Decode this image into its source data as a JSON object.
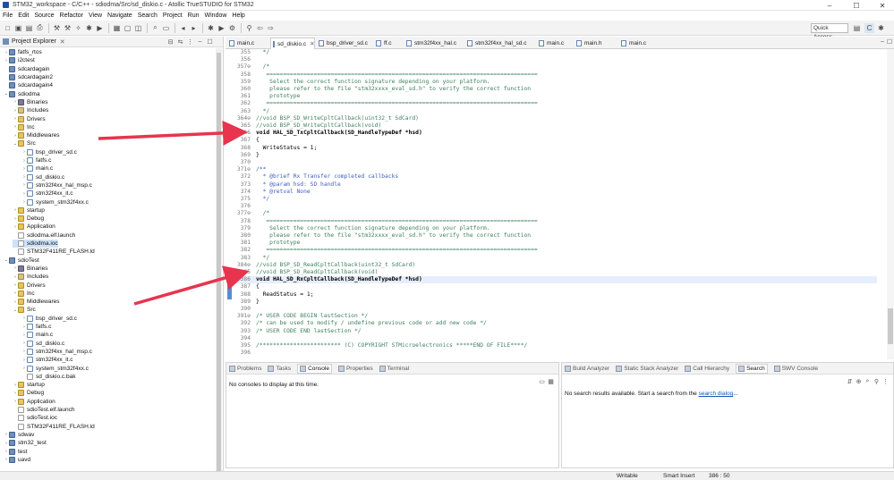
{
  "window": {
    "title": "STM32_workspace - C/C++ - sdiodma/Src/sd_diskio.c - Atollic TrueSTUDIO for STM32"
  },
  "menu": [
    "File",
    "Edit",
    "Source",
    "Refactor",
    "View",
    "Navigate",
    "Search",
    "Project",
    "Run",
    "Window",
    "Help"
  ],
  "quick_access": "Quick Access",
  "explorer": {
    "title": "Project Explorer",
    "items": [
      {
        "label": "fatfs_rtos",
        "depth": 0,
        "kind": "proj",
        "arrow": "›"
      },
      {
        "label": "i2ctest",
        "depth": 0,
        "kind": "proj",
        "arrow": "›"
      },
      {
        "label": "sdcardagain",
        "depth": 0,
        "kind": "proj",
        "arrow": ""
      },
      {
        "label": "sdcardagain2",
        "depth": 0,
        "kind": "proj",
        "arrow": ""
      },
      {
        "label": "sdcardagain4",
        "depth": 0,
        "kind": "proj",
        "arrow": ""
      },
      {
        "label": "sdiodma",
        "depth": 0,
        "kind": "proj",
        "arrow": "⌄"
      },
      {
        "label": "Binaries",
        "depth": 1,
        "kind": "bin",
        "arrow": "›"
      },
      {
        "label": "Includes",
        "depth": 1,
        "kind": "inc",
        "arrow": "›"
      },
      {
        "label": "Drivers",
        "depth": 1,
        "kind": "fold",
        "arrow": "›"
      },
      {
        "label": "Inc",
        "depth": 1,
        "kind": "fold",
        "arrow": "›"
      },
      {
        "label": "Middlewares",
        "depth": 1,
        "kind": "fold",
        "arrow": "›"
      },
      {
        "label": "Src",
        "depth": 1,
        "kind": "src",
        "arrow": "⌄"
      },
      {
        "label": "bsp_driver_sd.c",
        "depth": 2,
        "kind": "cfile",
        "arrow": "›"
      },
      {
        "label": "fatfs.c",
        "depth": 2,
        "kind": "cfile",
        "arrow": "›"
      },
      {
        "label": "main.c",
        "depth": 2,
        "kind": "cfile",
        "arrow": "›"
      },
      {
        "label": "sd_diskio.c",
        "depth": 2,
        "kind": "cfile",
        "arrow": "›"
      },
      {
        "label": "stm32f4xx_hal_msp.c",
        "depth": 2,
        "kind": "cfile",
        "arrow": "›"
      },
      {
        "label": "stm32f4xx_it.c",
        "depth": 2,
        "kind": "cfile",
        "arrow": "›"
      },
      {
        "label": "system_stm32f4xx.c",
        "depth": 2,
        "kind": "cfile",
        "arrow": "›"
      },
      {
        "label": "startup",
        "depth": 1,
        "kind": "fold",
        "arrow": "›"
      },
      {
        "label": "Debug",
        "depth": 1,
        "kind": "fold",
        "arrow": "›"
      },
      {
        "label": "Application",
        "depth": 1,
        "kind": "fold",
        "arrow": "›"
      },
      {
        "label": "sdiodma.elf.launch",
        "depth": 1,
        "kind": "file",
        "arrow": ""
      },
      {
        "label": "sdiodma.ioc",
        "depth": 1,
        "kind": "file",
        "arrow": "",
        "selected": true
      },
      {
        "label": "STM32F411RE_FLASH.ld",
        "depth": 1,
        "kind": "file",
        "arrow": ""
      },
      {
        "label": "sdioTest",
        "depth": 0,
        "kind": "proj",
        "arrow": "⌄"
      },
      {
        "label": "Binaries",
        "depth": 1,
        "kind": "bin",
        "arrow": "›"
      },
      {
        "label": "Includes",
        "depth": 1,
        "kind": "inc",
        "arrow": "›"
      },
      {
        "label": "Drivers",
        "depth": 1,
        "kind": "fold",
        "arrow": "›"
      },
      {
        "label": "Inc",
        "depth": 1,
        "kind": "fold",
        "arrow": "›"
      },
      {
        "label": "Middlewares",
        "depth": 1,
        "kind": "fold",
        "arrow": "›"
      },
      {
        "label": "Src",
        "depth": 1,
        "kind": "src",
        "arrow": "⌄"
      },
      {
        "label": "bsp_driver_sd.c",
        "depth": 2,
        "kind": "cfile",
        "arrow": "›"
      },
      {
        "label": "fatfs.c",
        "depth": 2,
        "kind": "cfile",
        "arrow": "›"
      },
      {
        "label": "main.c",
        "depth": 2,
        "kind": "cfile",
        "arrow": "›"
      },
      {
        "label": "sd_diskio.c",
        "depth": 2,
        "kind": "cfile",
        "arrow": "›"
      },
      {
        "label": "stm32f4xx_hal_msp.c",
        "depth": 2,
        "kind": "cfile",
        "arrow": "›"
      },
      {
        "label": "stm32f4xx_it.c",
        "depth": 2,
        "kind": "cfile",
        "arrow": "›"
      },
      {
        "label": "system_stm32f4xx.c",
        "depth": 2,
        "kind": "cfile",
        "arrow": "›"
      },
      {
        "label": "sd_diskio.c.bak",
        "depth": 2,
        "kind": "file",
        "arrow": ""
      },
      {
        "label": "startup",
        "depth": 1,
        "kind": "fold",
        "arrow": "›"
      },
      {
        "label": "Debug",
        "depth": 1,
        "kind": "fold",
        "arrow": "›"
      },
      {
        "label": "Application",
        "depth": 1,
        "kind": "fold",
        "arrow": "›"
      },
      {
        "label": "sdioTest.elf.launch",
        "depth": 1,
        "kind": "file",
        "arrow": ""
      },
      {
        "label": "sdioTest.ioc",
        "depth": 1,
        "kind": "file",
        "arrow": ""
      },
      {
        "label": "STM32F411RE_FLASH.ld",
        "depth": 1,
        "kind": "file",
        "arrow": ""
      },
      {
        "label": "sdwav",
        "depth": 0,
        "kind": "proj",
        "arrow": "›"
      },
      {
        "label": "stm32_test",
        "depth": 0,
        "kind": "proj",
        "arrow": "›"
      },
      {
        "label": "test",
        "depth": 0,
        "kind": "proj",
        "arrow": "›"
      },
      {
        "label": "uavd",
        "depth": 0,
        "kind": "proj",
        "arrow": "›"
      }
    ]
  },
  "editor_tabs": [
    {
      "label": "main.c",
      "active": false
    },
    {
      "label": "sd_diskio.c",
      "active": true
    },
    {
      "label": "bsp_driver_sd.c",
      "active": false
    },
    {
      "label": "ff.c",
      "active": false
    },
    {
      "label": "stm32f4xx_hal.c",
      "active": false
    },
    {
      "label": "stm32f4xx_hal_sd.c",
      "active": false
    },
    {
      "label": "main.c",
      "active": false
    },
    {
      "label": "main.h",
      "active": false
    },
    {
      "label": "main.c",
      "active": false
    }
  ],
  "code_lines": [
    {
      "n": "355",
      "t": "  */",
      "c": "c-com"
    },
    {
      "n": "356",
      "t": "",
      "c": ""
    },
    {
      "n": "357⊖",
      "t": "  /*",
      "c": "c-com"
    },
    {
      "n": "358",
      "t": "   ================================================================================",
      "c": "c-com"
    },
    {
      "n": "359",
      "t": "    Select the correct function signature depending on your platform.",
      "c": "c-com"
    },
    {
      "n": "360",
      "t": "    please refer to the file \"stm32xxxx_eval_sd.h\" to verify the correct function",
      "c": "c-com"
    },
    {
      "n": "361",
      "t": "    prototype",
      "c": "c-com"
    },
    {
      "n": "362",
      "t": "   ================================================================================",
      "c": "c-com"
    },
    {
      "n": "363",
      "t": "  */",
      "c": "c-com"
    },
    {
      "n": "364⊖",
      "t": "//void BSP_SD_WriteCpltCallback(uint32_t SdCard)",
      "c": "c-com"
    },
    {
      "n": "365",
      "t": "//void BSP_SD_WriteCpltCallback(void)",
      "c": "c-com"
    },
    {
      "n": "366",
      "t": "void HAL_SD_TxCpltCallback(SD_HandleTypeDef *hsd)",
      "c": "c-fn"
    },
    {
      "n": "367",
      "t": "{",
      "c": "c-def"
    },
    {
      "n": "368",
      "t": "  WriteStatus = 1;",
      "c": "c-def"
    },
    {
      "n": "369",
      "t": "}",
      "c": "c-def"
    },
    {
      "n": "370",
      "t": "",
      "c": ""
    },
    {
      "n": "371⊖",
      "t": "/**",
      "c": "c-doc"
    },
    {
      "n": "372",
      "t": "  * @brief Rx Transfer completed callbacks",
      "c": "c-doc"
    },
    {
      "n": "373",
      "t": "  * @param hsd: SD handle",
      "c": "c-doc"
    },
    {
      "n": "374",
      "t": "  * @retval None",
      "c": "c-doc"
    },
    {
      "n": "375",
      "t": "  */",
      "c": "c-doc"
    },
    {
      "n": "376",
      "t": "",
      "c": ""
    },
    {
      "n": "377⊖",
      "t": "  /*",
      "c": "c-com"
    },
    {
      "n": "378",
      "t": "   ================================================================================",
      "c": "c-com"
    },
    {
      "n": "379",
      "t": "    Select the correct function signature depending on your platform.",
      "c": "c-com"
    },
    {
      "n": "380",
      "t": "    please refer to the file \"stm32xxxx_eval_sd.h\" to verify the correct function",
      "c": "c-com"
    },
    {
      "n": "381",
      "t": "    prototype",
      "c": "c-com"
    },
    {
      "n": "382",
      "t": "   ================================================================================",
      "c": "c-com"
    },
    {
      "n": "383",
      "t": "  */",
      "c": "c-com"
    },
    {
      "n": "384⊖",
      "t": "//void BSP_SD_ReadCpltCallback(uint32_t SdCard)",
      "c": "c-com"
    },
    {
      "n": "385",
      "t": "//void BSP_SD_ReadCpltCallback(void)",
      "c": "c-com"
    },
    {
      "n": "386",
      "t": "void HAL_SD_RxCpltCallback(SD_HandleTypeDef *hsd)",
      "c": "c-fn",
      "current": true
    },
    {
      "n": "387",
      "t": "{",
      "c": "c-def"
    },
    {
      "n": "388",
      "t": "  ReadStatus = 1;",
      "c": "c-def"
    },
    {
      "n": "389",
      "t": "}",
      "c": "c-def"
    },
    {
      "n": "390",
      "t": "",
      "c": ""
    },
    {
      "n": "391⊖",
      "t": "/* USER CODE BEGIN lastSection */",
      "c": "c-com"
    },
    {
      "n": "392",
      "t": "/* can be used to modify / undefine previous code or add new code */",
      "c": "c-com"
    },
    {
      "n": "393",
      "t": "/* USER CODE END lastSection */",
      "c": "c-com"
    },
    {
      "n": "394",
      "t": "",
      "c": ""
    },
    {
      "n": "395",
      "t": "/************************ (C) COPYRIGHT STMicroelectronics *****END OF FILE****/",
      "c": "c-com"
    },
    {
      "n": "396",
      "t": "",
      "c": ""
    }
  ],
  "console_panel": {
    "tabs": [
      "Problems",
      "Tasks",
      "Console",
      "Properties",
      "Terminal"
    ],
    "active": "Console",
    "message": "No consoles to display at this time."
  },
  "search_panel": {
    "tabs": [
      "Build Analyzer",
      "Static Stack Analyzer",
      "Call Hierarchy",
      "Search",
      "SWV Console"
    ],
    "active": "Search",
    "message": "No search results available. Start a search from the ",
    "link": "search dialog",
    "suffix": "..."
  },
  "status": {
    "mode": "Writable",
    "insert": "Smart Insert",
    "position": "386 : 50"
  },
  "annotation_color": "#e8344e"
}
